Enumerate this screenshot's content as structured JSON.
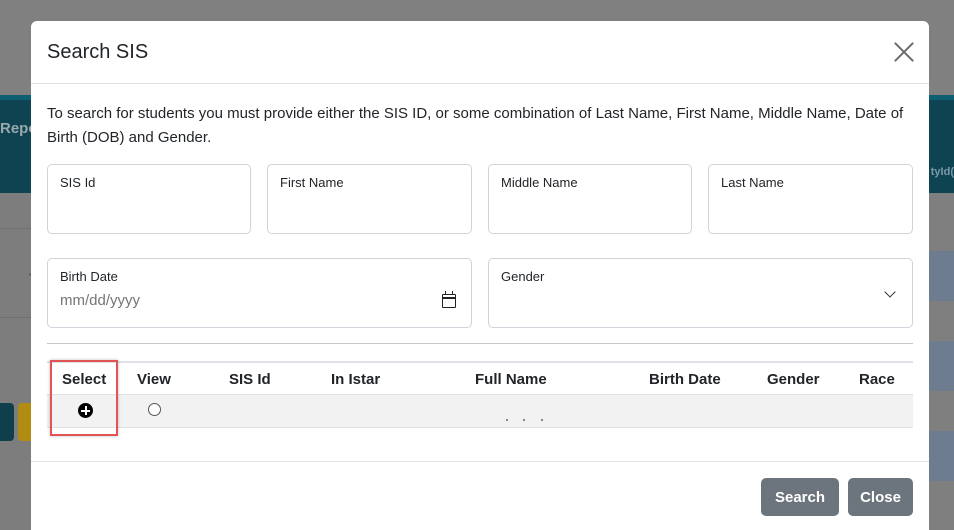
{
  "background": {
    "nav_fragment": "Repo",
    "right_fragment": "tyId("
  },
  "modal": {
    "title": "Search SIS",
    "instructions": "To search for students you must provide either the SIS ID, or some combination of Last Name, First Name, Middle Name, Date of Birth (DOB) and Gender.",
    "fields": {
      "sis_id": {
        "label": "SIS Id",
        "value": ""
      },
      "first_name": {
        "label": "First Name",
        "value": ""
      },
      "middle_name": {
        "label": "Middle Name",
        "value": ""
      },
      "last_name": {
        "label": "Last Name",
        "value": ""
      },
      "birth_date": {
        "label": "Birth Date",
        "placeholder": "mm/dd/yyyy"
      },
      "gender": {
        "label": "Gender",
        "value": ""
      }
    },
    "table": {
      "columns": [
        "Select",
        "View",
        "SIS Id",
        "In Istar",
        "Full Name",
        "Birth Date",
        "Gender",
        "Race"
      ],
      "rows": [
        {
          "sis_id": "",
          "in_istar": "",
          "full_name": "",
          "birth_date": "",
          "gender": "",
          "race": ""
        }
      ]
    },
    "buttons": {
      "search": "Search",
      "close": "Close"
    }
  },
  "icons": [
    "close-icon",
    "calendar-icon",
    "chevron-down-icon",
    "add-circle-icon"
  ],
  "colors": {
    "overlay_band": "#0e4451",
    "button_gray": "#6c757d",
    "highlight": "#e05454"
  }
}
